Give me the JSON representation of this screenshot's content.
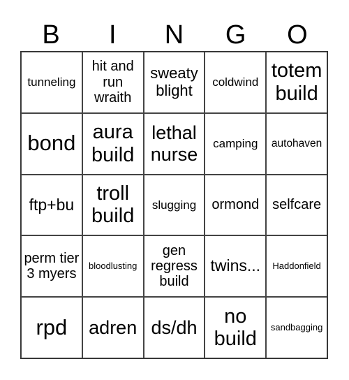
{
  "header": {
    "letters": [
      "B",
      "I",
      "N",
      "G",
      "O"
    ]
  },
  "cells": [
    "tunneling",
    "hit and run wraith",
    "sweaty blight",
    "coldwind",
    "totem build",
    "bond",
    "aura build",
    "lethal nurse",
    "camping",
    "autohaven",
    "ftp+bu",
    "troll build",
    "slugging",
    "ormond",
    "selfcare",
    "perm tier 3 myers",
    "bloodlusting",
    "gen regress build",
    "twins...",
    "Haddonfield",
    "rpd",
    "adren",
    "ds/dh",
    "no build",
    "sandbagging"
  ]
}
